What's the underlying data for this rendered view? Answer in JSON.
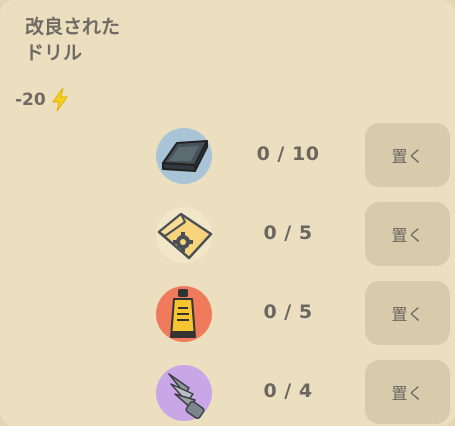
{
  "recipe": {
    "title": "改良された\nドリル",
    "energy_cost": "-20",
    "energy_icon": "lightning-bolt-icon",
    "accent_energy": "#f4d21e"
  },
  "materials": [
    {
      "name_icon": "metal-ingot-icon",
      "icon_bg": "#a8c4d6",
      "count": "0 / 10",
      "button": "置く"
    },
    {
      "name_icon": "gear-parts-box-icon",
      "icon_bg": "#f2e6c9",
      "count": "0 / 5",
      "button": "置く"
    },
    {
      "name_icon": "glue-tube-icon",
      "icon_bg": "#ef7b5c",
      "count": "0 / 5",
      "button": "置く"
    },
    {
      "name_icon": "drill-bit-icon",
      "icon_bg": "#c9a6e6",
      "count": "0 / 4",
      "button": "置く"
    }
  ]
}
